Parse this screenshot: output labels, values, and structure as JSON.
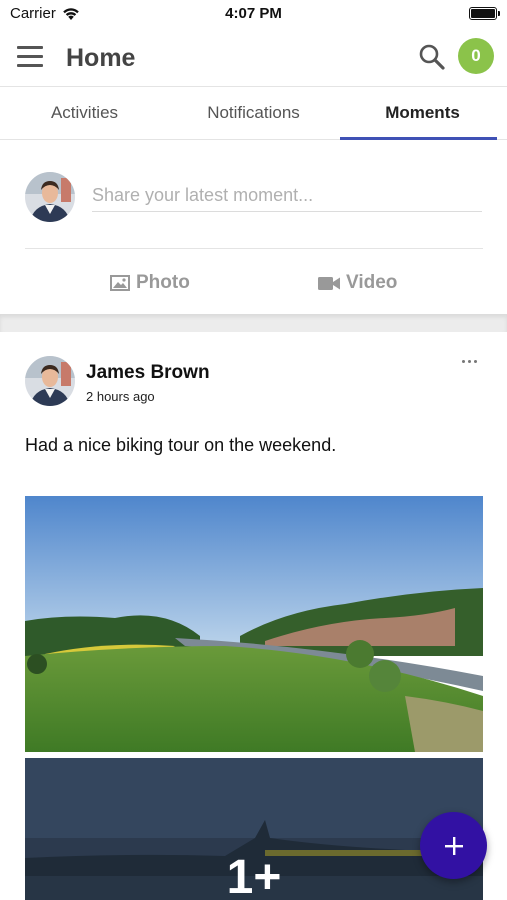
{
  "status_bar": {
    "carrier": "Carrier",
    "time": "4:07 PM"
  },
  "app_bar": {
    "title": "Home",
    "notification_count": "0"
  },
  "tabs": [
    {
      "label": "Activities",
      "active": false
    },
    {
      "label": "Notifications",
      "active": false
    },
    {
      "label": "Moments",
      "active": true
    }
  ],
  "composer": {
    "placeholder": "Share your latest moment...",
    "photo_label": "Photo",
    "video_label": "Video"
  },
  "post": {
    "author": "James Brown",
    "time": "2 hours ago",
    "text": "Had a nice biking tour on the weekend.",
    "more_photos": "1+"
  },
  "colors": {
    "accent": "#3f51b5",
    "badge": "#8bc34a",
    "fab": "#3211a3"
  }
}
